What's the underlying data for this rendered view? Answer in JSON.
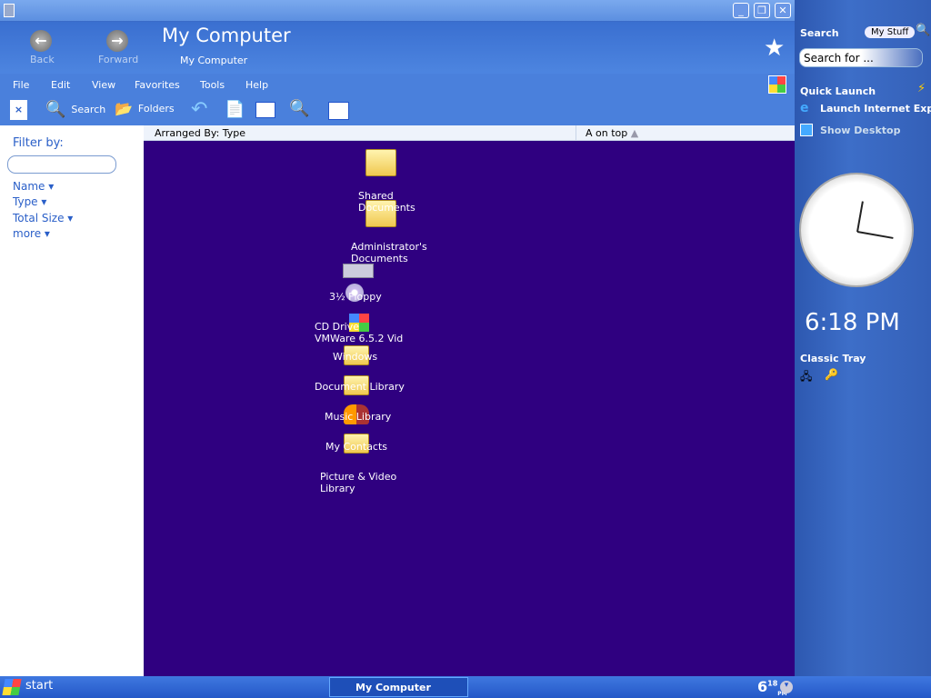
{
  "window": {
    "title": "My Computer",
    "subtitle": "My Computer",
    "back": "Back",
    "forward": "Forward",
    "min": "_",
    "max": "❐",
    "close": "✕"
  },
  "menu": [
    "File",
    "Edit",
    "View",
    "Favorites",
    "Tools",
    "Help"
  ],
  "toolbar": {
    "search": "Search",
    "folders": "Folders"
  },
  "filter": {
    "title": "Filter by:",
    "placeholder": "",
    "links": [
      "Name",
      "Type",
      "Total Size",
      "more"
    ]
  },
  "columns": {
    "arranged": "Arranged By: Type",
    "ontop": "A on top"
  },
  "items": [
    {
      "label": "Shared\nDocuments",
      "icon": "folder-icon"
    },
    {
      "label": "Administrator's\nDocuments",
      "icon": "folder-icon"
    },
    {
      "label": "3½ Floppy",
      "icon": "floppy-drive-icon"
    },
    {
      "label": "CD Drive",
      "icon": "cd-drive-icon"
    },
    {
      "label": "VMWare 6.5.2 Vid",
      "icon": "windows-drive-icon"
    },
    {
      "label": "Windows",
      "icon": "windows-folder-icon"
    },
    {
      "label": "Document Library",
      "icon": "document-library-icon"
    },
    {
      "label": "Music Library",
      "icon": "music-library-icon"
    },
    {
      "label": "My Contacts",
      "icon": "contacts-icon"
    },
    {
      "label": "Picture & Video\nLibrary",
      "icon": "picture-library-icon"
    }
  ],
  "sidebar": {
    "search_title": "Search",
    "my_stuff": "My Stuff",
    "search_placeholder": "Search for ...",
    "quick_launch": "Quick Launch",
    "launch_ie": "Launch Internet Explorer",
    "show_desktop": "Show Desktop",
    "time": "6:18 PM",
    "classic_tray": "Classic Tray"
  },
  "taskbar": {
    "start": "start",
    "task": "My Computer",
    "clock_hour": "6",
    "clock_min": "18",
    "clock_ampm": "PM"
  }
}
